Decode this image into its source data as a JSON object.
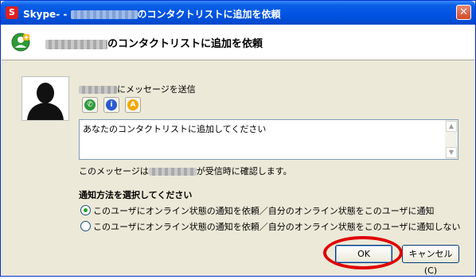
{
  "window": {
    "app_name": "Skype",
    "title_separator": "- -",
    "title_suffix": "のコンタクトリストに追加を依頼",
    "icons": {
      "app": "skype-icon",
      "close": "close-icon"
    }
  },
  "header": {
    "title_suffix": "のコンタクトリストに追加を依頼",
    "icon": "add-contact-icon"
  },
  "message": {
    "send_label_suffix": "にメッセージを送信",
    "toolbar_icons": [
      "call-icon",
      "info-icon",
      "profile-icon"
    ],
    "text": "あなたのコンタクトリストに追加してください",
    "note_prefix": "このメッセージは",
    "note_suffix": "が受信時に確認します。"
  },
  "notification": {
    "heading": "通知方法を選択してください",
    "options": [
      {
        "label": "このユーザにオンライン状態の通知を依頼／自分のオンライン状態をこのユーザに通知",
        "selected": true
      },
      {
        "label": "このユーザにオンライン状態の通知を依頼／自分のオンライン状態をこのユーザに通知しない",
        "selected": false
      }
    ]
  },
  "buttons": {
    "ok": "OK",
    "cancel": "キャンセル (C)"
  },
  "colors": {
    "title_bar": "#0054e3",
    "highlight_ring": "#e00000",
    "radio_selected": "#21a121"
  }
}
